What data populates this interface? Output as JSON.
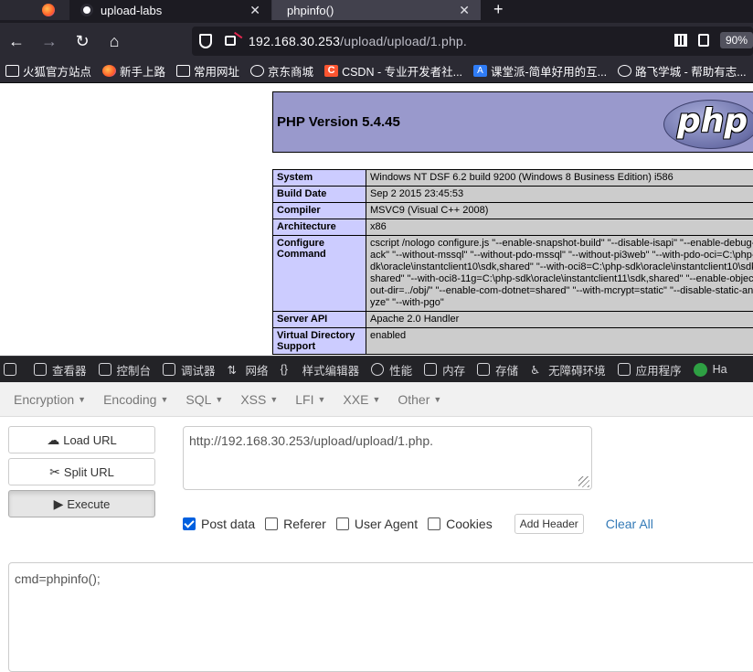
{
  "tabs": [
    {
      "title": ""
    },
    {
      "title": "upload-labs"
    },
    {
      "title": "phpinfo()"
    }
  ],
  "nav": {
    "url_host": "192.168.30.253",
    "url_path": "/upload/upload/1.php.",
    "zoom": "90%"
  },
  "bookmarks": [
    {
      "icon": "folder-icon",
      "label": "火狐官方站点"
    },
    {
      "icon": "firefox-icon",
      "label": "新手上路"
    },
    {
      "icon": "folder-icon",
      "label": "常用网址"
    },
    {
      "icon": "globe-icon",
      "label": "京东商城"
    },
    {
      "icon": "csdn-icon",
      "label": "CSDN - 专业开发者社..."
    },
    {
      "icon": "ketangpai-icon",
      "label": "课堂派-简单好用的互..."
    },
    {
      "icon": "globe-icon",
      "label": "路飞学城 - 帮助有志..."
    }
  ],
  "phpinfo": {
    "version": "PHP Version 5.4.45",
    "logo_text": "php",
    "rows": [
      {
        "key": "System",
        "value": "Windows NT DSF 6.2 build 9200 (Windows 8 Business Edition) i586"
      },
      {
        "key": "Build Date",
        "value": "Sep 2 2015 23:45:53"
      },
      {
        "key": "Compiler",
        "value": "MSVC9 (Visual C++ 2008)"
      },
      {
        "key": "Architecture",
        "value": "x86"
      },
      {
        "key": "Configure Command",
        "value": "cscript /nologo configure.js \"--enable-snapshot-build\" \"--disable-isapi\" \"--enable-debug-pack\" \"--without-mssql\" \"--without-pdo-mssql\" \"--without-pi3web\" \"--with-pdo-oci=C:\\php-sdk\\oracle\\instantclient10\\sdk,shared\" \"--with-oci8=C:\\php-sdk\\oracle\\instantclient10\\sdk,shared\" \"--with-oci8-11g=C:\\php-sdk\\oracle\\instantclient11\\sdk,shared\" \"--enable-object-out-dir=../obj/\" \"--enable-com-dotnet=shared\" \"--with-mcrypt=static\" \"--disable-static-analyze\" \"--with-pgo\""
      },
      {
        "key": "Server API",
        "value": "Apache 2.0 Handler"
      },
      {
        "key": "Virtual Directory Support",
        "value": "enabled"
      }
    ]
  },
  "devtools": {
    "tabs": [
      {
        "icon": "inspector-icon",
        "label": "查看器"
      },
      {
        "icon": "console-icon",
        "label": "控制台"
      },
      {
        "icon": "debugger-icon",
        "label": "调试器"
      },
      {
        "icon": "network-icon",
        "label": "网络"
      },
      {
        "icon": "style-editor-icon",
        "label": "样式编辑器"
      },
      {
        "icon": "performance-icon",
        "label": "性能"
      },
      {
        "icon": "memory-icon",
        "label": "内存"
      },
      {
        "icon": "storage-icon",
        "label": "存储"
      },
      {
        "icon": "accessibility-icon",
        "label": "无障碍环境"
      },
      {
        "icon": "application-icon",
        "label": "应用程序"
      },
      {
        "icon": "hackbar-icon",
        "label": "Ha"
      }
    ]
  },
  "hackbar": {
    "menu": [
      "Encryption",
      "Encoding",
      "SQL",
      "XSS",
      "LFI",
      "XXE",
      "Other"
    ],
    "buttons": {
      "load": "Load URL",
      "split": "Split URL",
      "execute": "Execute"
    },
    "url_value": "http://192.168.30.253/upload/upload/1.php.",
    "options": [
      {
        "label": "Post data",
        "checked": true
      },
      {
        "label": "Referer",
        "checked": false
      },
      {
        "label": "User Agent",
        "checked": false
      },
      {
        "label": "Cookies",
        "checked": false
      }
    ],
    "add_header": "Add Header",
    "clear_all": "Clear All",
    "post_value": "cmd=phpinfo();"
  }
}
